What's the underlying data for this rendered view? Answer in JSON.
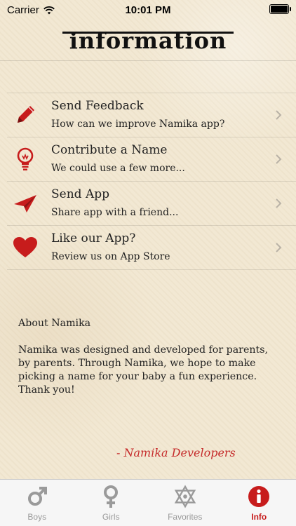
{
  "status_bar": {
    "carrier": "Carrier",
    "time": "10:01 PM"
  },
  "header": {
    "title": "information"
  },
  "rows": [
    {
      "label": "Send Feedback",
      "sub": "How can we improve Namika app?",
      "icon": "pencil-icon"
    },
    {
      "label": "Contribute a Name",
      "sub": "We could use a few more...",
      "icon": "lightbulb-icon"
    },
    {
      "label": "Send App",
      "sub": "Share app with a friend...",
      "icon": "paper-plane-icon"
    },
    {
      "label": "Like our App?",
      "sub": "Review us on App Store",
      "icon": "heart-icon"
    }
  ],
  "about": {
    "heading": "About Namika",
    "body": "Namika was designed and developed for parents, by parents. Through Namika, we hope to make picking a name for your baby a fun experience. Thank you!",
    "signature": "- Namika Developers"
  },
  "tabs": [
    {
      "label": "Boys",
      "icon": "male-symbol-icon"
    },
    {
      "label": "Girls",
      "icon": "female-symbol-icon"
    },
    {
      "label": "Favorites",
      "icon": "star-of-david-icon"
    },
    {
      "label": "Info",
      "icon": "info-icon",
      "active": true
    }
  ],
  "colors": {
    "accent": "#c71c1c",
    "tab_inactive": "#9a9a9a"
  }
}
